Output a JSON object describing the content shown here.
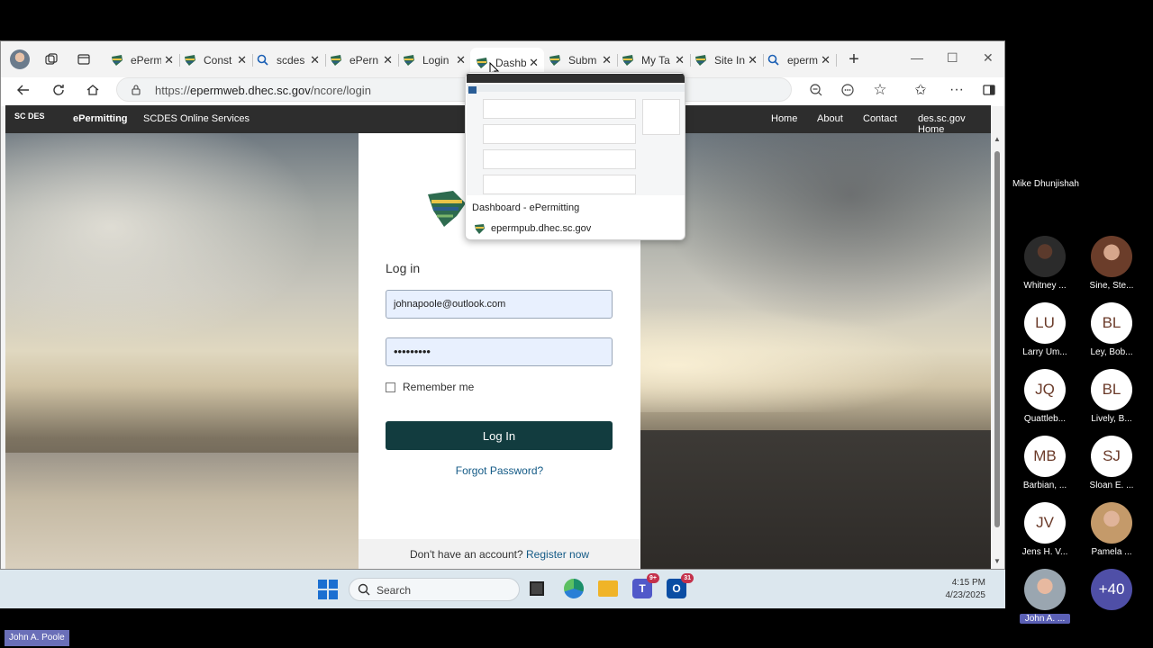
{
  "browser": {
    "tabs": [
      {
        "title": "ePerm",
        "icon": "sc-leaf-icon",
        "active": false
      },
      {
        "title": "Const",
        "icon": "sc-leaf-icon",
        "active": false
      },
      {
        "title": "scdes",
        "icon": "search-icon",
        "active": false
      },
      {
        "title": "ePern",
        "icon": "sc-leaf-icon",
        "active": false
      },
      {
        "title": "Login",
        "icon": "sc-leaf-icon",
        "active": false
      },
      {
        "title": "Dashb",
        "icon": "sc-leaf-icon",
        "active": true
      },
      {
        "title": "Subm",
        "icon": "sc-leaf-icon",
        "active": false
      },
      {
        "title": "My Ta",
        "icon": "sc-leaf-icon",
        "active": false
      },
      {
        "title": "Site In",
        "icon": "sc-leaf-icon",
        "active": false
      },
      {
        "title": "eperm",
        "icon": "search-icon",
        "active": false
      }
    ],
    "url_prefix": "https://",
    "url_host": "epermweb.dhec.sc.gov",
    "url_path": "/ncore/login"
  },
  "site": {
    "logo_text": "SC DES",
    "brand": "ePermitting",
    "subtitle": "SCDES Online Services",
    "nav": [
      "Home",
      "About",
      "Contact",
      "des.sc.gov Home"
    ]
  },
  "login": {
    "heading": "Log in",
    "email_value": "johnapoole@outlook.com",
    "password_mask": "•••••••••",
    "remember_label": "Remember me",
    "button_label": "Log In",
    "forgot_label": "Forgot Password?",
    "register_prompt": "Don't have an account?",
    "register_link": "Register now"
  },
  "tab_preview": {
    "title": "Dashboard - ePermitting",
    "domain": "epermpub.dhec.sc.gov"
  },
  "taskbar": {
    "search_placeholder": "Search",
    "time": "4:15 PM",
    "date": "4/23/2025",
    "badges": {
      "teams": "9+",
      "outlook": "31"
    }
  },
  "meeting": {
    "presenter": "Mike Dhunjishah",
    "participants": [
      {
        "name": "Whitney ...",
        "initials": ""
      },
      {
        "name": "Sine, Ste...",
        "initials": ""
      },
      {
        "name": "Larry Um...",
        "initials": "LU"
      },
      {
        "name": "Ley, Bob...",
        "initials": "BL"
      },
      {
        "name": "Quattleb...",
        "initials": "JQ"
      },
      {
        "name": "Lively, B...",
        "initials": "BL"
      },
      {
        "name": "Barbian, ...",
        "initials": "MB"
      },
      {
        "name": "Sloan E. ...",
        "initials": "SJ"
      },
      {
        "name": "Jens H. V...",
        "initials": "JV"
      },
      {
        "name": "Pamela ...",
        "initials": ""
      },
      {
        "name": "John A. ...",
        "initials": ""
      },
      {
        "name": "",
        "initials": "+40"
      }
    ],
    "self_name": "John A. Poole"
  },
  "colors": {
    "site_bar": "#2d2d2d",
    "login_button": "#123c3f",
    "link": "#135a86",
    "avatar_initials_bg": "#ffffff",
    "more_bg": "#4f4fa7"
  }
}
